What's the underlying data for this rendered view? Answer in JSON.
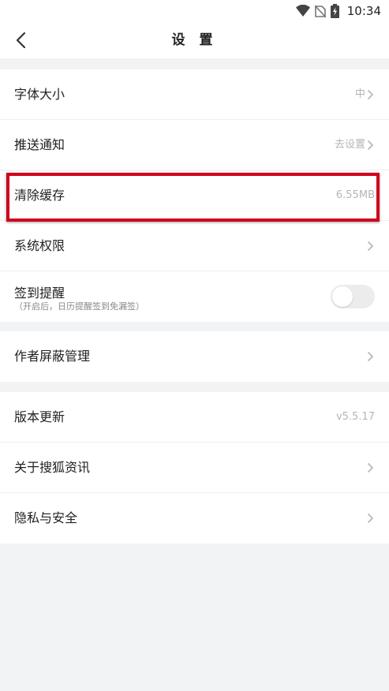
{
  "status_bar": {
    "time": "10:34",
    "icons": [
      "wifi-icon",
      "no-sim-icon",
      "battery-charging-icon"
    ]
  },
  "header": {
    "title": "设 置",
    "back_icon": "chevron-left-icon"
  },
  "groups": [
    {
      "items": [
        {
          "label": "字体大小",
          "value": "中",
          "chevron": true
        },
        {
          "label": "推送通知",
          "value": "去设置",
          "chevron": true
        },
        {
          "label": "清除缓存",
          "value": "6.55MB",
          "chevron": false,
          "highlighted": true
        },
        {
          "label": "系统权限",
          "value": "",
          "chevron": true
        },
        {
          "label": "签到提醒",
          "sublabel": "（开启后，日历提醒签到免漏签）",
          "toggle": false
        }
      ]
    },
    {
      "items": [
        {
          "label": "作者屏蔽管理",
          "chevron": true
        }
      ]
    },
    {
      "items": [
        {
          "label": "版本更新",
          "value": "v5.5.17",
          "chevron": false
        },
        {
          "label": "关于搜狐资讯",
          "chevron": true
        },
        {
          "label": "隐私与安全",
          "chevron": true
        }
      ]
    }
  ],
  "colors": {
    "background": "#f2f3f5",
    "highlight": "#d0021b",
    "secondary_text": "#b5b5b5"
  }
}
